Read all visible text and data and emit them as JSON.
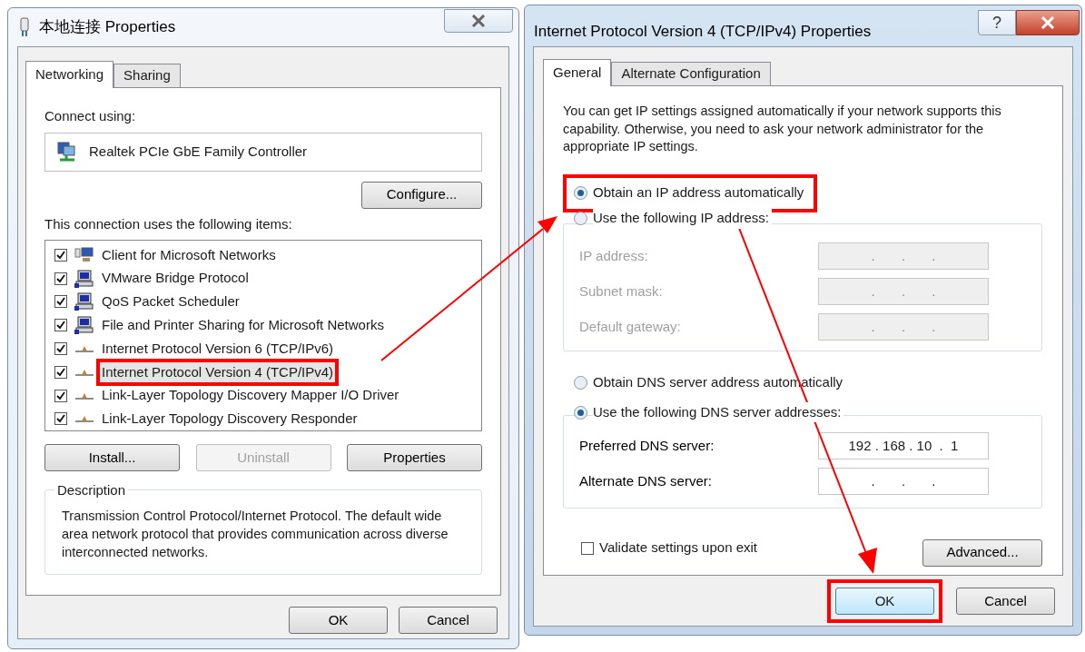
{
  "left_dialog": {
    "title": "本地连接 Properties",
    "tabs": [
      {
        "label": "Networking",
        "selected": true
      },
      {
        "label": "Sharing",
        "selected": false
      }
    ],
    "connect_using": {
      "label": "Connect using:",
      "adapter": "Realtek PCIe GbE Family Controller"
    },
    "configure_button": {
      "label": "Configure..."
    },
    "items_label": "This connection uses the following items:",
    "items": [
      {
        "label": "Client for Microsoft Networks",
        "kind": "client",
        "checked": true,
        "selected": false,
        "highlighted": false
      },
      {
        "label": "VMware Bridge Protocol",
        "kind": "service",
        "checked": true,
        "selected": false,
        "highlighted": false
      },
      {
        "label": "QoS Packet Scheduler",
        "kind": "service",
        "checked": true,
        "selected": false,
        "highlighted": false
      },
      {
        "label": "File and Printer Sharing for Microsoft Networks",
        "kind": "service",
        "checked": true,
        "selected": false,
        "highlighted": false
      },
      {
        "label": "Internet Protocol Version 6 (TCP/IPv6)",
        "kind": "protocol",
        "checked": true,
        "selected": false,
        "highlighted": false
      },
      {
        "label": "Internet Protocol Version 4 (TCP/IPv4)",
        "kind": "protocol",
        "checked": true,
        "selected": true,
        "highlighted": true
      },
      {
        "label": "Link-Layer Topology Discovery Mapper I/O Driver",
        "kind": "protocol",
        "checked": true,
        "selected": false,
        "highlighted": false
      },
      {
        "label": "Link-Layer Topology Discovery Responder",
        "kind": "protocol",
        "checked": true,
        "selected": false,
        "highlighted": false
      }
    ],
    "item_buttons": [
      {
        "label": "Install...",
        "disabled": false
      },
      {
        "label": "Uninstall",
        "disabled": true
      },
      {
        "label": "Properties",
        "disabled": false
      }
    ],
    "description": {
      "title": "Description",
      "text": "Transmission Control Protocol/Internet Protocol. The default wide area network protocol that provides communication across diverse interconnected networks."
    },
    "buttons": [
      {
        "label": "OK"
      },
      {
        "label": "Cancel"
      }
    ]
  },
  "right_dialog": {
    "title": "Internet Protocol Version 4 (TCP/IPv4) Properties",
    "help_button": "?",
    "tabs": [
      {
        "label": "General",
        "selected": true
      },
      {
        "label": "Alternate Configuration",
        "selected": false
      }
    ],
    "intro": "You can get IP settings assigned automatically if your network supports this capability. Otherwise, you need to ask your network administrator for the appropriate IP settings.",
    "ip_options": [
      {
        "label": "Obtain an IP address automatically",
        "selected": true,
        "highlighted": true
      },
      {
        "label": "Use the following IP address:",
        "selected": false,
        "highlighted": false
      }
    ],
    "ip_fields": [
      {
        "label": "IP address:",
        "value": ".       .       .",
        "disabled": true
      },
      {
        "label": "Subnet mask:",
        "value": ".       .       .",
        "disabled": true
      },
      {
        "label": "Default gateway:",
        "value": ".       .       .",
        "disabled": true
      }
    ],
    "dns_options": [
      {
        "label": "Obtain DNS server address automatically",
        "selected": false
      },
      {
        "label": "Use the following DNS server addresses:",
        "selected": true
      }
    ],
    "dns_fields": [
      {
        "label": "Preferred DNS server:",
        "value": "192 . 168 . 10  .  1",
        "disabled": false
      },
      {
        "label": "Alternate DNS server:",
        "value": ".       .       .",
        "disabled": false
      }
    ],
    "validate": {
      "label": "Validate settings upon exit",
      "checked": false
    },
    "advanced_button": {
      "label": "Advanced..."
    },
    "buttons": [
      {
        "label": "OK",
        "default": true,
        "highlighted": true
      },
      {
        "label": "Cancel",
        "default": false,
        "highlighted": false
      }
    ]
  }
}
